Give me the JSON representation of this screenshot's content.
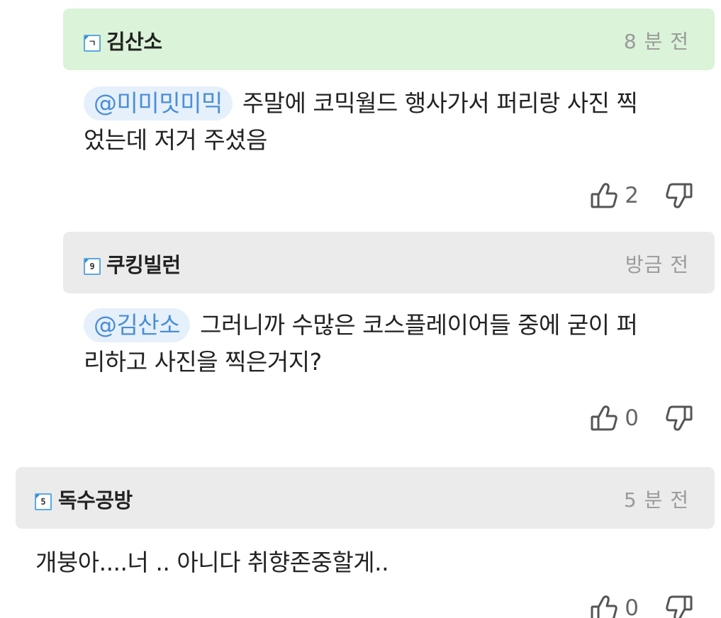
{
  "comments": [
    {
      "level": "ㄱ",
      "username": "김산소",
      "time": "8 분 전",
      "mention": "@미미밋미믹",
      "text": "주말에 코믹월드 행사가서 퍼리랑 사진 찍었는데 저거 주셨음",
      "text_line1": "주말에 코믹월드 행사가서 퍼리랑 사진 찍",
      "text_line2": "었는데 저거 주셨음",
      "likes": "2",
      "header_color": "#dbf3d8"
    },
    {
      "level": "9",
      "username": "쿠킹빌런",
      "time": "방금 전",
      "mention": "@김산소",
      "text": "그러니까 수많은 코스플레이어들 중에 굳이 퍼리하고 사진을 찍은거지?",
      "text_line1": "그러니까 수많은 코스플레이어들 중에 굳이 퍼",
      "text_line2": "리하고 사진을 찍은거지?",
      "likes": "0",
      "header_color": "#ebebeb"
    },
    {
      "level": "5",
      "username": "독수공방",
      "time": "5 분 전",
      "text": "개붕아....너 .. 아니다 취향존중할게..",
      "likes": "0",
      "header_color": "#ebebeb"
    }
  ],
  "icons": {
    "like": "thumbs-up-outline",
    "dislike": "thumbs-down-outline",
    "badge": "level-badge"
  },
  "colors": {
    "mention_text": "#4a8fd6",
    "mention_bg": "#e6f0fb",
    "time_text": "#9a9a9a"
  }
}
